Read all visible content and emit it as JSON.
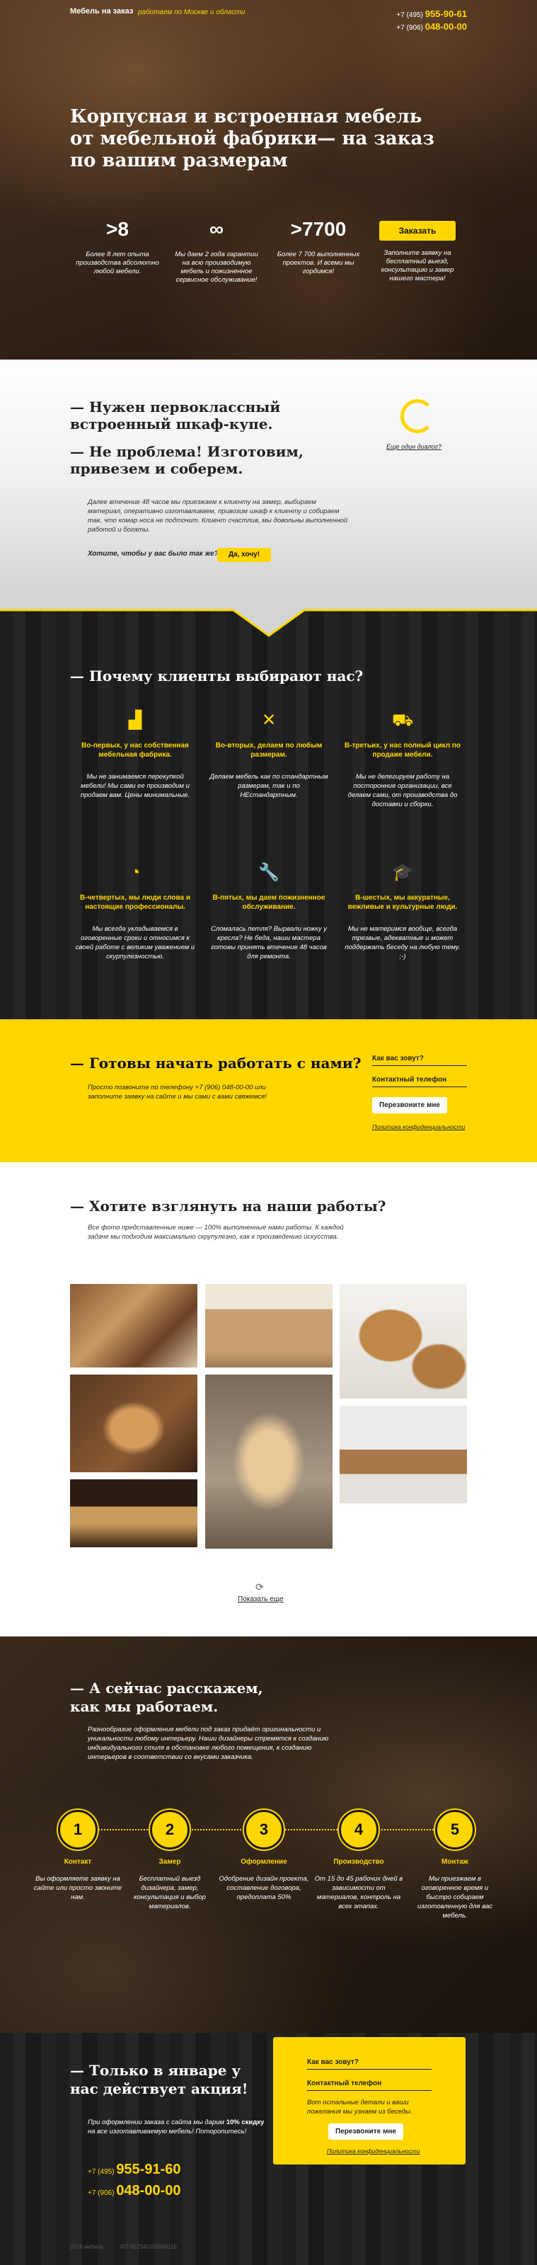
{
  "header": {
    "brand": "Мебель на заказ",
    "tagline": "работаем по Москве и области",
    "phone1_prefix": "+7 (495)",
    "phone1": "955-90-61",
    "phone2_prefix": "+7 (906)",
    "phone2": "048-00-00"
  },
  "hero": {
    "title": "Корпусная и встроенная мебель от мебельной фабрики— на заказ по вашим размерам",
    "stats": [
      {
        "num": ">8",
        "txt": "Более 8 лет опыта производства абсолютно любой мебели."
      },
      {
        "num": "∞",
        "txt": "Мы даем 2 года гарантии на всю производимую мебель и пожизненное сервисное обслуживание!"
      },
      {
        "num": ">7700",
        "txt": "Более 7 700 выполненных проектов. И всеми мы гордимся!"
      }
    ],
    "order_button": "Заказать",
    "order_txt": "Заполните заявку на бесплатный выезд, консультацию и замер нашего мастера!"
  },
  "intro": {
    "h1": "— Нужен первоклассный встроенный шкаф-купе.",
    "h2": "— Не проблема! Изготовим, привезем и соберем.",
    "text": "Далее втечение 48 часов мы приезжаем к клиенту на замер, выбираем материал, оперативно изготавливаем, привозим шкаф к клиенту и собираем так, что комар носа не подточит. Клиент счастлив, мы довольны выполненной работой и богаты.",
    "question": "Хотите, чтобы у вас было так же?",
    "yes": "Да, хочу!",
    "another": "Еще один диалог?"
  },
  "why": {
    "title": "— Почему клиенты выбирают нас?",
    "items": [
      {
        "icon": "factory-icon",
        "glyph": "▟",
        "title": "Во-первых, у нас собственная мебельная фабрика.",
        "text": "Мы не занимаемся перекупкой мебели! Мы сами ее производим и продаем вам. Цены минимальные."
      },
      {
        "icon": "tools-icon",
        "glyph": "✕",
        "title": "Во-вторых, делаем по любым размерам.",
        "text": "Делаем мебель как по стандартным размерам, так и по НЕстандартным."
      },
      {
        "icon": "truck-icon",
        "glyph": "⛟",
        "title": "В-третьих, у нас полный цикл по продаже мебели.",
        "text": "Мы не делегируем работу на посторонние организации, все делаем сами, от производства до доставки и сборки."
      },
      {
        "icon": "clock-icon",
        "glyph": "◔",
        "title": "В-четвертых, мы люди слова и настоящие профессионалы.",
        "text": "Мы всегда укладываемся в оговоренные сроки и относимся к своей работе с великим уважением и скурпулезностью."
      },
      {
        "icon": "wrench-icon",
        "glyph": "🔧",
        "title": "В-пятых, мы даем пожизненное обслуживание.",
        "text": "Сломалась петля? Вырвали ножку у кресла? Не беда, наши мастера готовы принять втечение 48 часов для ремонта."
      },
      {
        "icon": "graduate-icon",
        "glyph": "🎓",
        "title": "В-шестых, мы аккуратные, вежливые и культурные люди.",
        "text": "Мы не материмся вообще, всегда трезвые, адекватные и может поддержать беседу на любую тему. ;-)"
      }
    ]
  },
  "cta": {
    "title": "— Готовы начать работать с нами?",
    "text": "Просто позвоните по телефону +7 (906) 048-00-00 или заполните заявку на сайте и мы сами с вами свяжемся!",
    "name_label": "Как вас зовут?",
    "phone_label": "Контактный телефон",
    "button": "Перезвоните мне",
    "privacy": "Политика конфиденциальности"
  },
  "gallery": {
    "title": "— Хотите взглянуть на наши работы?",
    "text": "Все фото представленные ниже — 100% выполненные нами работы. К каждой задаче мы подходим максимально скрупулезно, как к произведению искусства.",
    "more": "Показать еще"
  },
  "process": {
    "title": "— А сейчас расскажем, как мы работаем.",
    "text": "Разнообразие оформления мебели под заказ придаёт оригинальности и уникальности любому интерьеру. Наши дизайнеры стремятся к созданию индивидуального стиля в обстановке любого помещения, к созданию интерьеров в соответствии со вкусами заказчика.",
    "steps": [
      {
        "n": "1",
        "name": "Контакт",
        "text": "Вы оформляете заявку на сайте или просто звоните нам."
      },
      {
        "n": "2",
        "name": "Замер",
        "text": "Бесплатный выезд дизайнера, замер, консультация и выбор материалов."
      },
      {
        "n": "3",
        "name": "Оформление",
        "text": "Одобрение дизайн проекта, составление договора, предоплата 50%"
      },
      {
        "n": "4",
        "name": "Производство",
        "text": "От 15 до 45 рабочих дней в зависимости от материалов, контроль на всех этапах."
      },
      {
        "n": "5",
        "name": "Монтаж",
        "text": "Мы приезжаем в оговоренное время и быстро собираем изготовленную для вас мебель."
      }
    ]
  },
  "action": {
    "title": "— Только в январе у нас действует акция!",
    "text1": "При оформлении заказа с сайта мы дарим",
    "bold": "10% скидку",
    "text2": "на все изготавливаемую мебель! Поторопитесь!",
    "phone1_prefix": "+7 (495)",
    "phone1": "955-91-60",
    "phone2_prefix": "+7 (906)",
    "phone2": "048-00-00",
    "name_label": "Как вас зовут?",
    "phone_label": "Контактный телефон",
    "form_text": "Вот остальные детали и ваши пожелания мы узнаем из беседы.",
    "button": "Перезвоните мне",
    "privacy": "Политика конфиденциальности"
  },
  "footer": {
    "left": "2016 мебель",
    "right": "ИП 312345050009116"
  }
}
